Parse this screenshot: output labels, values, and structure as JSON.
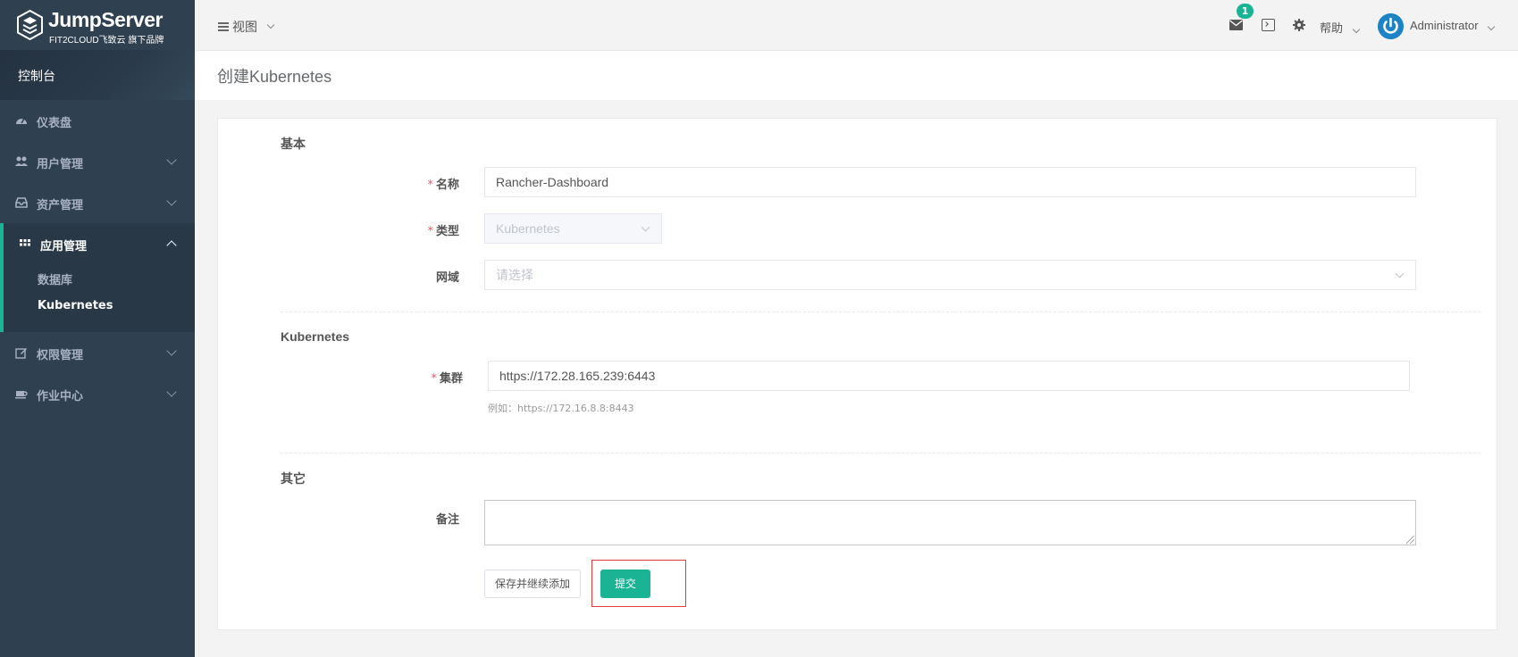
{
  "brand": {
    "title": "JumpServer",
    "subtitle": "FIT2CLOUD飞致云 旗下品牌",
    "accent": "#1ab394"
  },
  "sidebar": {
    "console_label": "控制台",
    "items": [
      {
        "label": "仪表盘",
        "icon": "dashboard-icon",
        "expandable": false
      },
      {
        "label": "用户管理",
        "icon": "users-icon",
        "expandable": true
      },
      {
        "label": "资产管理",
        "icon": "inbox-icon",
        "expandable": true
      },
      {
        "label": "应用管理",
        "icon": "grid-icon",
        "expandable": true,
        "expanded": true,
        "children": [
          {
            "label": "数据库"
          },
          {
            "label": "Kubernetes",
            "current": true
          }
        ]
      },
      {
        "label": "权限管理",
        "icon": "edit-icon",
        "expandable": true
      },
      {
        "label": "作业中心",
        "icon": "coffee-icon",
        "expandable": true
      }
    ]
  },
  "topbar": {
    "view_label": "视图",
    "mail_count": "1",
    "help_label": "帮助",
    "user_name": "Administrator"
  },
  "page": {
    "title": "创建Kubernetes"
  },
  "form": {
    "sections": {
      "basic": "基本",
      "kubernetes": "Kubernetes",
      "other": "其它"
    },
    "name": {
      "label": "名称",
      "value": "Rancher-Dashboard"
    },
    "type": {
      "label": "类型",
      "value": "Kubernetes"
    },
    "domain": {
      "label": "网域",
      "placeholder": "请选择"
    },
    "cluster": {
      "label": "集群",
      "value": "https://172.28.165.239:6443",
      "hint": "例如：https://172.16.8.8:8443"
    },
    "comment": {
      "label": "备注",
      "value": ""
    },
    "buttons": {
      "save_continue": "保存并继续添加",
      "submit": "提交"
    }
  }
}
